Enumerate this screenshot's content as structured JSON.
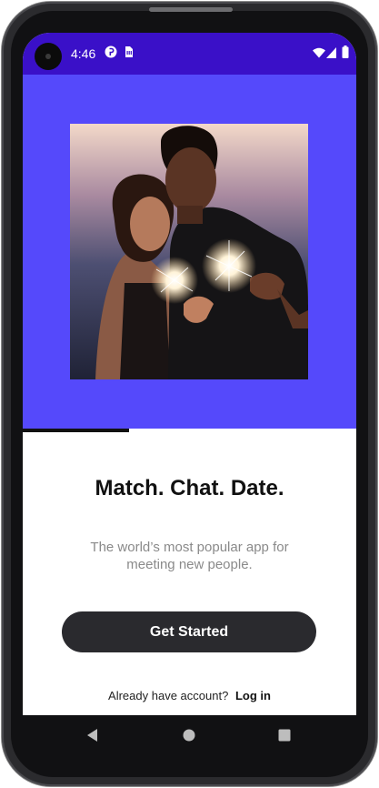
{
  "status_bar": {
    "time": "4:46",
    "background": "#3a10c8",
    "icons": [
      "pinterest-icon",
      "sim-card-icon",
      "wifi-icon",
      "signal-icon",
      "battery-icon"
    ]
  },
  "hero": {
    "background": "#5549fb",
    "image": "couple-with-sparklers-photo"
  },
  "onboarding": {
    "progress": 0.32,
    "title": "Match. Chat. Date.",
    "subtitle": "The world’s most popular app for meeting new people.",
    "cta_label": "Get Started",
    "login_prompt": "Already have account?",
    "login_label": "Log in"
  },
  "nav_bar": {
    "buttons": [
      "back-icon",
      "home-icon",
      "recents-icon"
    ]
  }
}
